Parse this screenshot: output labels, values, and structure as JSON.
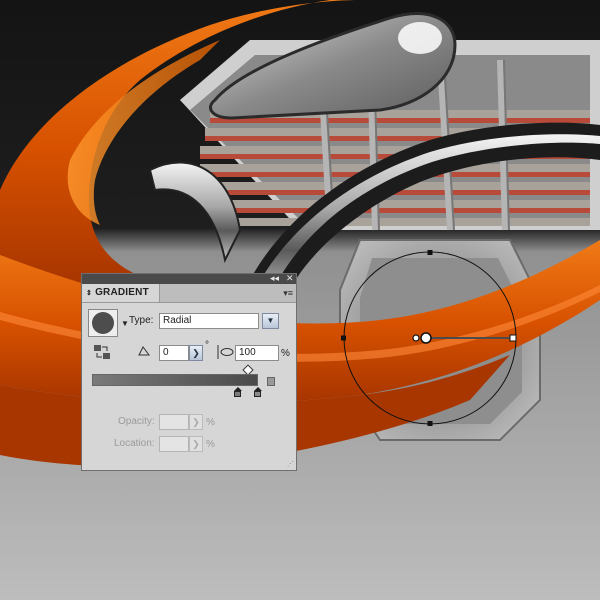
{
  "panel": {
    "title": "GRADIENT",
    "collapse_glyph": "◂◂",
    "close_glyph": "✕",
    "menu_glyph": "▾≡",
    "swatch_color": "#4d4d4d",
    "type_label": "Type:",
    "type_value": "Radial",
    "angle_value": "0",
    "angle_unit": "°",
    "aspect_value": "100",
    "aspect_unit": "%",
    "opacity_label": "Opacity:",
    "opacity_unit": "%",
    "location_label": "Location:",
    "location_unit": "%",
    "gradient_start_color": "#7a7a7a",
    "gradient_end_color": "#4a4a4a"
  },
  "colors": {
    "orange": "#e05a00",
    "background_dark": "#141414",
    "background_light": "#bdbdbd"
  }
}
